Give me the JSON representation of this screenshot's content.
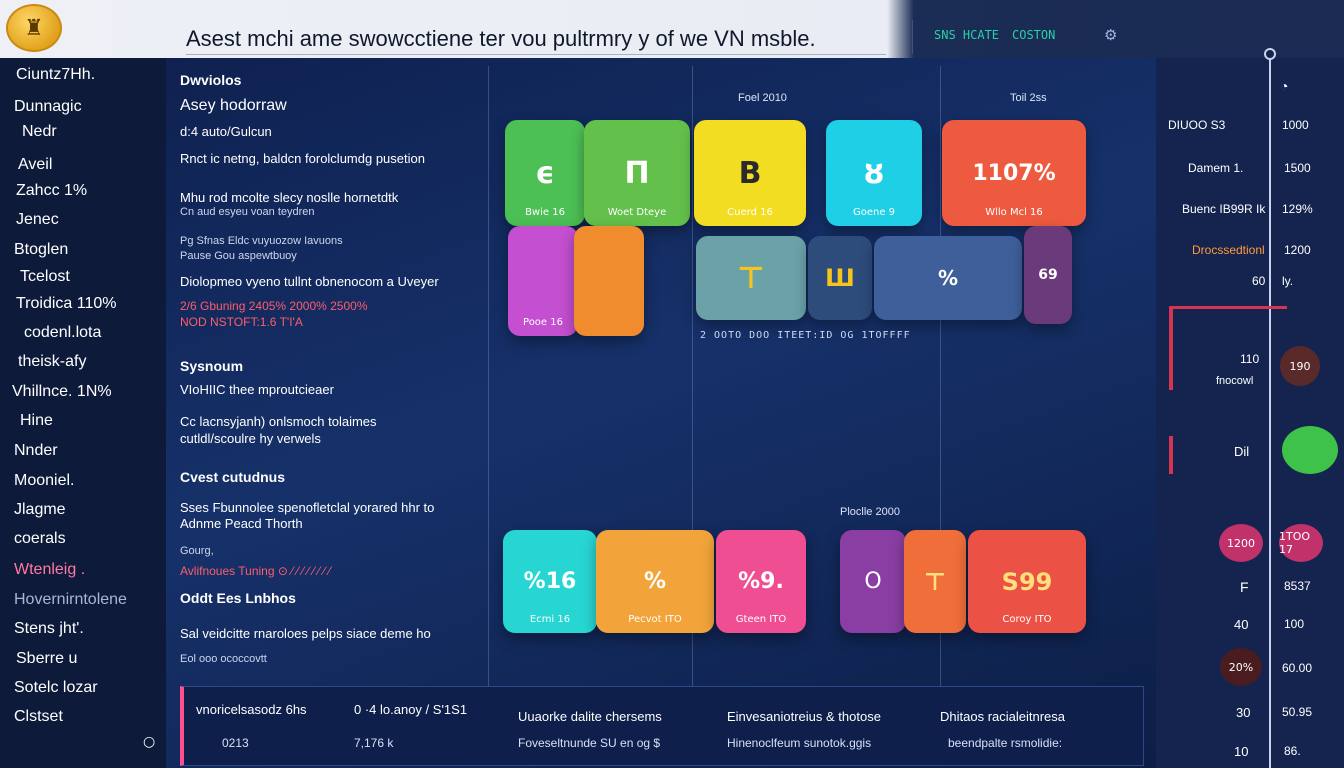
{
  "header": {
    "logo_glyph": "♜",
    "title": "Asest mchi ame swowcctiene ter vou pultrmry y of we  VN  msble.",
    "status_a": "SNS HCATE",
    "status_b": "COSTON",
    "settings_glyph": "⚙"
  },
  "sidebar": {
    "items": [
      "Ciuntz7Hh.",
      "Dunnagic",
      "Nedr",
      "Aveil",
      "Zahcc 1%",
      "Jenec",
      "Btoglen",
      "Tcelost",
      "Troidica 110%",
      "codenl.lota",
      "theisk-afy",
      "Vhillnce.  1N%",
      "Hine",
      "Nnder",
      "Mooniel.",
      "Jlagme",
      "coerals",
      "Wtenleig .",
      "Hovernirntolene",
      "Stens  jht'.",
      "Sberre  u",
      "Sotelc  lozar",
      "Clstset"
    ],
    "toggle_glyph": "○"
  },
  "textcol": {
    "h1": "Dwviolos",
    "l1": "Asey  hodorraw",
    "l2": "d:4  auto/Gulcun",
    "l3": "Rnct ic  netng, baldcn forolclumdg pusetion",
    "l4a": "Mhu  rod  mcolte slecy  noslle hornetdtk",
    "l4b": "Cn  aud  esyeu voan teydren",
    "l5a": "Pg Sfnas Eldc  vuyuozow Iavuons",
    "l5b": "Pause  Gou aspewtbuoy",
    "l6": "Diolopmeo vyeno tullnt obnenocom a  Uveyer",
    "l7a": "2/6  Gbuning  2405%  2000%  2500%",
    "l7b": "NOD  NSTOFT:1.6  T'I'A",
    "h2": "Sysnoum",
    "l8": "VIoHIIC  thee  mproutcieaer",
    "l9a": "Cc lacnsyjanh) onlsmoch  tolaimes",
    "l9b": "cutldl/scoulre hy verwels",
    "h3": "Cvest cutudnus",
    "l10a": "Sses  Fbunnolee  spenofletclal  yorared hhr  to",
    "l10b": "Adnme Peacd Thorth",
    "l11": "Gourg,",
    "l12": "Avlifnoues  Tuning   ⊙  ⁄ ⁄ ⁄ ⁄ ⁄ ⁄ ⁄ ⁄",
    "h4": "Oddt  Ees Lnbhos",
    "l13": "Sal  veidcitte rnaroloes  pelps  siace  deme  ho",
    "l14": "Eol  ooo  ococcovtt"
  },
  "grid": {
    "col_label_1": "Foel 2010",
    "col_label_2": "Toil  2ss",
    "col_label_3": "Ploclle 2000",
    "row1": [
      {
        "glyph": "ϵ",
        "cap": "Bwie  16",
        "color": "#4cbf55"
      },
      {
        "glyph": "Π",
        "cap": "Woet  Dteye",
        "color": "#63c04b"
      },
      {
        "glyph": "B",
        "cap": "Cuerd  16",
        "color": "#f2dd22",
        "dark": true
      },
      {
        "glyph": "ȣ",
        "cap": "Goene  9",
        "color": "#1fcfe6"
      },
      {
        "glyph": "1107%",
        "cap": "Wllo  Mcl  16",
        "color": "#ee5a3f"
      }
    ],
    "row2": [
      {
        "glyph": "",
        "cap": "Pooe  16",
        "color": "#c44fd0"
      },
      {
        "glyph": "",
        "cap": "",
        "color": "#f08c2d"
      },
      {
        "glyph": "⊤",
        "cap": "",
        "color": "#6aa2a8"
      },
      {
        "glyph": "Ш",
        "cap": "",
        "color": "#2d4b7b"
      },
      {
        "glyph": "%",
        "cap": "",
        "color": "#3f5f9a"
      },
      {
        "glyph": "69",
        "cap": "",
        "color": "#6b3a7a"
      }
    ],
    "row2_caption": "2  OOTO DOO  ITEET:ID OG  1TOFFFF",
    "row3": [
      {
        "glyph": "%16",
        "cap": "Ecmi  16",
        "color": "#27d6d3"
      },
      {
        "glyph": "%",
        "cap": "Pecvot  ITO",
        "color": "#f2a33a"
      },
      {
        "glyph": "%9.",
        "cap": "Gteen  ITO",
        "color": "#ef4f92"
      },
      {
        "glyph": "O",
        "cap": "",
        "color": "#8a3ea3"
      },
      {
        "glyph": "⊤",
        "cap": "",
        "color": "#f06e3a"
      },
      {
        "glyph": "S99",
        "cap": "Coroy  ITO",
        "color": "#ec5146"
      }
    ]
  },
  "footer": {
    "c1a": "vnoricelsasodz 6hs",
    "c1b": "0213",
    "c2a": "0 ·4  lo.anoy / S'1S1",
    "c2b": "7,176  k",
    "c3a": "Uuaorke dalite chersems",
    "c3b": "Foveseltnunde  SU en  og  $",
    "c4a": "Einvesaniotreius &  thotose",
    "c4b": "Hinenoclfeum sunotok.ggis",
    "c5a": "Dhitaos racialeitnresa",
    "c5b": "beendpalte rsmolidie:"
  },
  "right": {
    "top_icon": "◔",
    "r1a": "DIUOO  S3",
    "r1b": "1000",
    "r2a": "Damem   1.",
    "r2b": "1500",
    "r3a": "Buenc  IB99R  Ik",
    "r3b": "129%",
    "r4a": "Drocssedtionl",
    "r4b": "1200",
    "r5a": "60",
    "r5b": "ly.",
    "r6a": "110",
    "r6b": "190",
    "r7a": "fnocowl",
    "r8b": "Dil",
    "r9a": "1200",
    "r9b": "1TOO 17",
    "r10a": "F",
    "r10b": "8537",
    "r11a": "40",
    "r11b": "100",
    "r12a": "20%",
    "r12b": "60.00",
    "r13a": "30",
    "r13b": "50.95",
    "r14a": "10",
    "r14b": "86."
  }
}
